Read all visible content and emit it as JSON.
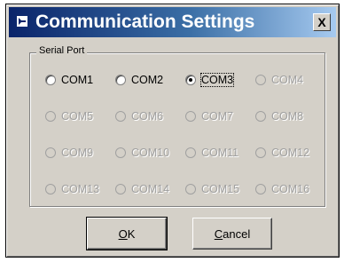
{
  "window": {
    "title": "Communication Settings",
    "close_label": "X"
  },
  "serial_port": {
    "label": "Serial Port",
    "options": [
      [
        {
          "label": "COM1",
          "checked": false,
          "enabled": true
        },
        {
          "label": "COM2",
          "checked": false,
          "enabled": true
        },
        {
          "label": "COM3",
          "checked": true,
          "enabled": true
        },
        {
          "label": "COM4",
          "checked": false,
          "enabled": false
        }
      ],
      [
        {
          "label": "COM5",
          "checked": false,
          "enabled": false
        },
        {
          "label": "COM6",
          "checked": false,
          "enabled": false
        },
        {
          "label": "COM7",
          "checked": false,
          "enabled": false
        },
        {
          "label": "COM8",
          "checked": false,
          "enabled": false
        }
      ],
      [
        {
          "label": "COM9",
          "checked": false,
          "enabled": false
        },
        {
          "label": "COM10",
          "checked": false,
          "enabled": false
        },
        {
          "label": "COM11",
          "checked": false,
          "enabled": false
        },
        {
          "label": "COM12",
          "checked": false,
          "enabled": false
        }
      ],
      [
        {
          "label": "COM13",
          "checked": false,
          "enabled": false
        },
        {
          "label": "COM14",
          "checked": false,
          "enabled": false
        },
        {
          "label": "COM15",
          "checked": false,
          "enabled": false
        },
        {
          "label": "COM16",
          "checked": false,
          "enabled": false
        }
      ]
    ]
  },
  "buttons": {
    "ok_mnemonic": "O",
    "ok_rest": "K",
    "cancel_mnemonic": "C",
    "cancel_rest": "ancel"
  }
}
